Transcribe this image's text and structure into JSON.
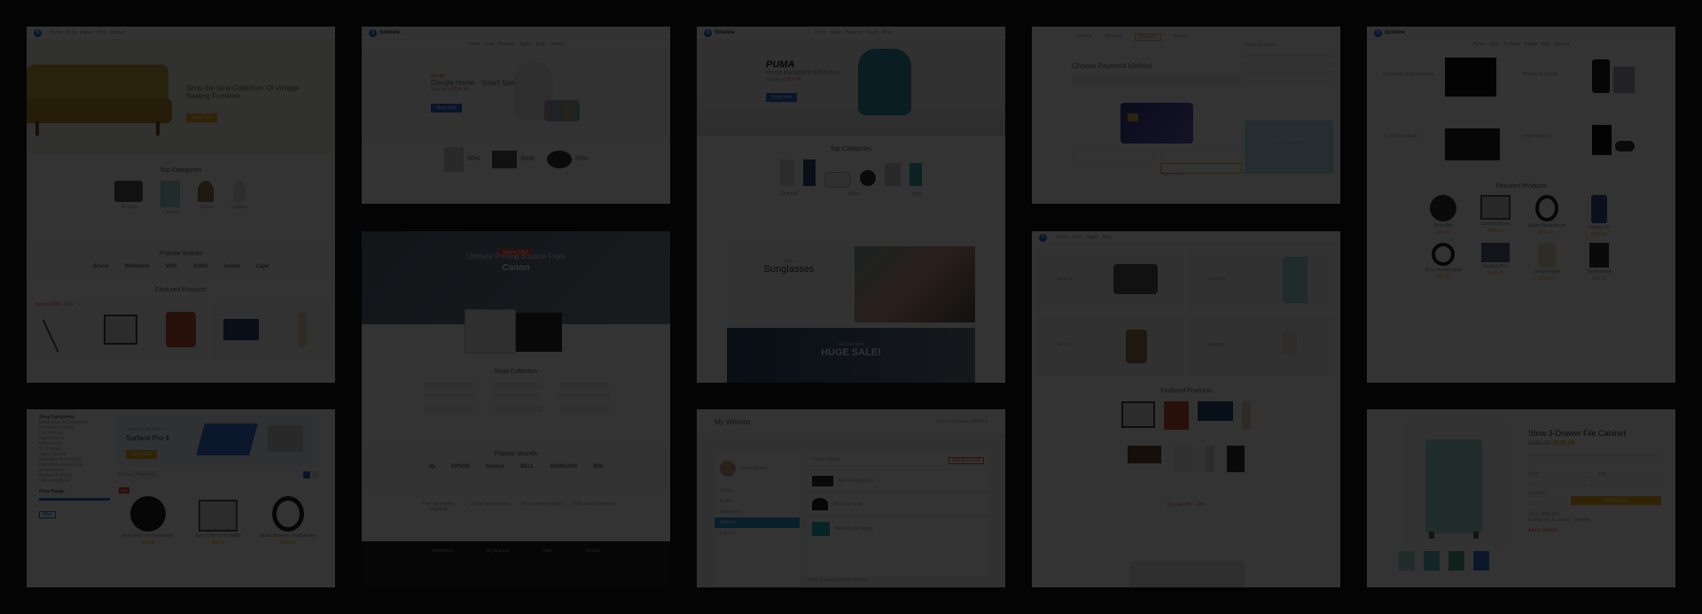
{
  "colors": {
    "background": "#141414",
    "accent_yellow": "#f2b01e",
    "accent_blue": "#2a6bd6",
    "overlay": "rgba(0,0,0,0.80)"
  },
  "t1": {
    "hero_title_1": "Shop the New Collection Of Vintage",
    "hero_title_2": "Seating Furniture",
    "hero_btn": "Shop Now",
    "categories_title": "Top Categories",
    "categories": [
      "Seating",
      "Cabinets",
      "Tables",
      "Lighting"
    ],
    "brands_title": "Popular Brands",
    "brands": [
      "Bruno",
      "Weinstein",
      "VKR",
      "JUNO",
      "Anima",
      "Cape"
    ],
    "featured_title": "Featured Products",
    "offer": "Special Offer - 20%"
  },
  "t2": {
    "logo": "Soleline",
    "hero_brand": "Google",
    "hero_title": "Google Home - Smart Speaker",
    "hero_price_prefix": "Starting at",
    "hero_price": "$129.00",
    "hero_btn": "Shop Now",
    "promos": [
      {
        "pct": "50%"
      },
      {
        "pct": "$900"
      },
      {
        "pct": "30%"
      }
    ]
  },
  "t3": {
    "logo": "Soleline",
    "hero_brand": "PUMA",
    "hero_title": "Puma Backpack Collection",
    "hero_price_prefix": "Starting at",
    "hero_price": "$37.94",
    "hero_btn": "Shop Now",
    "cat_title": "Top Categories",
    "categories": [
      "Clothing",
      "Shoes",
      "Bags"
    ],
    "sunglasses_kicker": "New",
    "sunglasses_title": "Sunglasses",
    "sale_kicker": "Get Discount",
    "sale_title": "HUGE SALE!"
  },
  "t4": {
    "tabs": [
      "Address",
      "Shipping",
      "Payment",
      "Review"
    ],
    "title": "Choose Payment Method",
    "summary_title": "Order Summary",
    "ad_title": "Lenovo Athena",
    "place_order": "Place Order"
  },
  "t5": {
    "logo": "Soleline",
    "products": [
      "Computers & Accessories",
      "Phones & Tablets",
      "TV, Video & Audio",
      "Video Games"
    ],
    "featured_title": "Featured Products",
    "items": [
      "Echo Dot",
      "Canon Camera",
      "Beats Headphones",
      "Galaxy S8",
      "Sony Headphones",
      "Surface Pro",
      "Smart Watch",
      "Tripod Stand"
    ],
    "prices": [
      "$39.99",
      "$199.99",
      "$249.99",
      "$599.99",
      "$89.99",
      "$899.99",
      "$299.99",
      "$29.99"
    ]
  },
  "t6": {
    "sidebar_title": "Shop Categories",
    "sidebar_items": [
      "Electronics & Computers",
      "Cameras & Photo",
      "Cell Phones",
      "Headphones",
      "Home Audio",
      "TV & Video",
      "Video Games",
      "Wearable Technology",
      "Household Appliances",
      "Accessories",
      "Kitchen & Dining",
      "Office Products"
    ],
    "price_filter": "Price Range",
    "filter_btn": "Filter",
    "ad_kicker": "Limited Time Offer",
    "ad_title": "Surface Pro 4",
    "ad_btn": "Shop Now",
    "sort_label": "Sort by",
    "sort_value": "Popularity",
    "products": [
      {
        "name": "Echo Dot 2nd Generation",
        "price": "$49.99",
        "sale": "Sale"
      },
      {
        "name": "Sony Cyber-shot W800",
        "price": "$89.99",
        "sale": ""
      },
      {
        "name": "Beats Wireless Headphones",
        "price": "$199.99",
        "sale": ""
      }
    ]
  },
  "t7": {
    "badge": "Special Offer",
    "hero_title": "Ultimate Printing Solution From",
    "hero_brand": "Canon",
    "shop_title": "Shop Collection",
    "brands_title": "Popular Brands",
    "brands": [
      "hp",
      "EPSON",
      "brother",
      "DELL",
      "SAMSUNG",
      "IBM"
    ],
    "features": [
      "Free Worldwide Shipping",
      "30 Day Money Back",
      "24/7 Customer Support",
      "100% Secure Payment"
    ],
    "footer_cols": [
      "Information",
      "My Account",
      "Help",
      "Contact"
    ]
  },
  "t8": {
    "title": "My Wishlist",
    "breadcrumb": "Home / Account / Wishlist",
    "user_name": "Daniel Adams",
    "menu": [
      "Orders",
      "Profile",
      "Addresses",
      "Wishlist",
      "Log Out"
    ],
    "active_menu": "Wishlist",
    "add_all": "Add All to Cart",
    "col_header": "Product Name",
    "items": [
      "Nike Revolution 4",
      "Nike Cap Logo",
      "Herschel Backpack"
    ],
    "footer_note": "Share your wishlist with friends"
  },
  "t9": {
    "categories": [
      "Seating",
      "Cabinets",
      "Tables",
      "Lighting"
    ],
    "featured_title": "Featured Products",
    "offer": "Special Offer - 20%"
  },
  "t10": {
    "title": "Stow 3-Drawer File Cabinet",
    "old_price": "$450.00",
    "price": "$230.00",
    "add_to_cart": "Add to Cart",
    "color_label": "Color",
    "size_label": "Size",
    "qty_label": "Quantity",
    "sku": "SKU: 7890-ABC",
    "category": "Categories: Furniture, Cabinets",
    "wishlist": "Add to Wishlist"
  }
}
